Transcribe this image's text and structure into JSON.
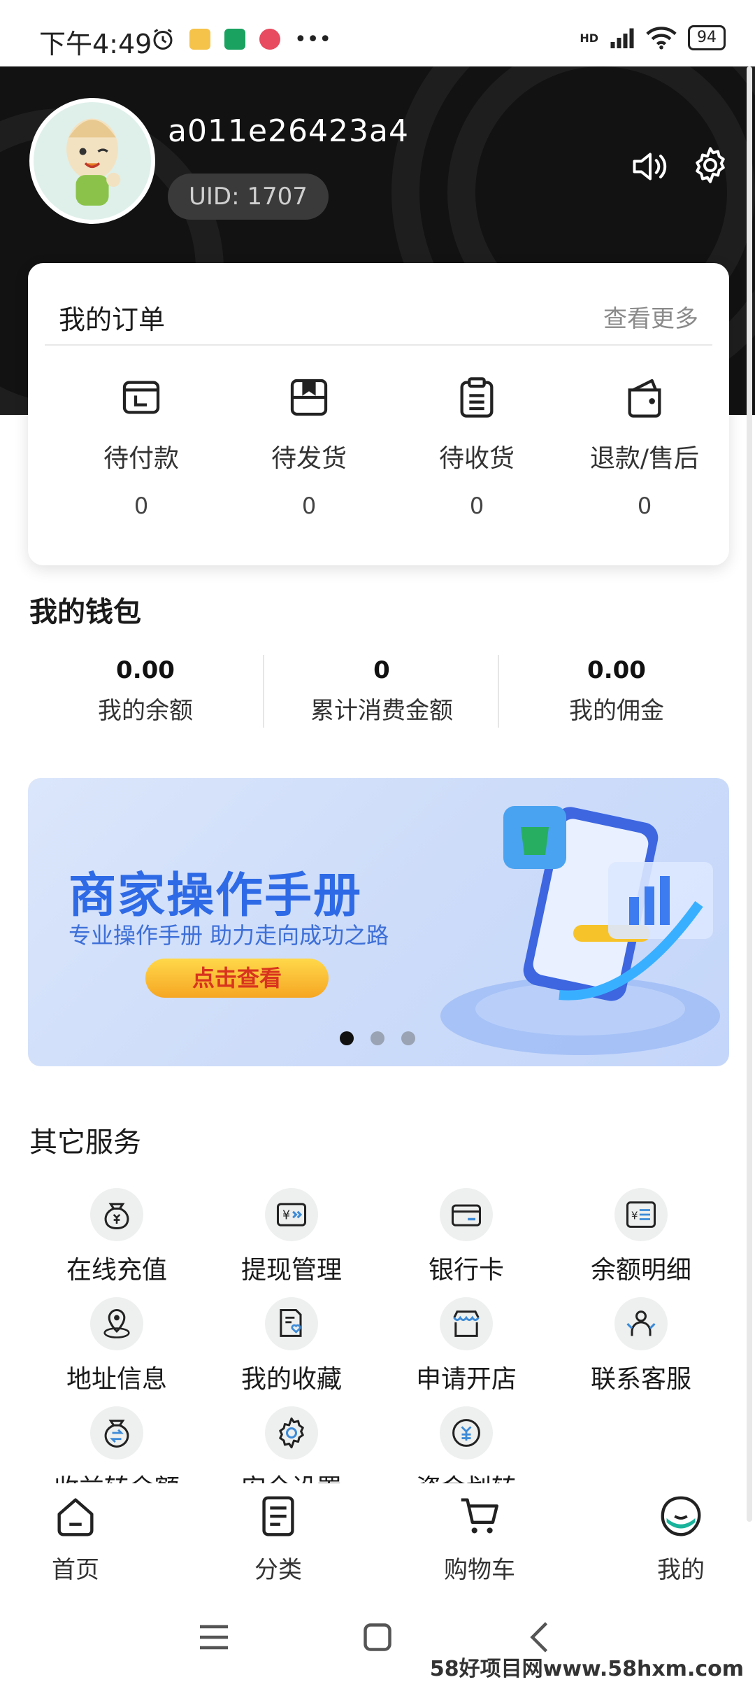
{
  "status_bar": {
    "time": "下午4:49",
    "network": "HD",
    "battery": "94"
  },
  "profile": {
    "username": "a011e26423a4",
    "uid": "UID: 1707"
  },
  "orders": {
    "title": "我的订单",
    "more": "查看更多",
    "items": [
      {
        "label": "待付款",
        "count": "0",
        "icon": "wallet-icon"
      },
      {
        "label": "待发货",
        "count": "0",
        "icon": "box-icon"
      },
      {
        "label": "待收货",
        "count": "0",
        "icon": "clipboard-icon"
      },
      {
        "label": "退款/售后",
        "count": "0",
        "icon": "bag-icon"
      }
    ]
  },
  "wallet": {
    "title": "我的钱包",
    "items": [
      {
        "value": "0.00",
        "label": "我的余额"
      },
      {
        "value": "0",
        "label": "累计消费金额"
      },
      {
        "value": "0.00",
        "label": "我的佣金"
      }
    ]
  },
  "banner": {
    "title": "商家操作手册",
    "subtitle": "专业操作手册 助力走向成功之路",
    "button": "点击查看",
    "page_count": 3,
    "active_page": 1
  },
  "services": {
    "title": "其它服务",
    "items": [
      {
        "label": "在线充值",
        "icon": "money-bag-icon"
      },
      {
        "label": "提现管理",
        "icon": "withdraw-icon"
      },
      {
        "label": "银行卡",
        "icon": "bank-card-icon"
      },
      {
        "label": "余额明细",
        "icon": "balance-detail-icon"
      },
      {
        "label": "地址信息",
        "icon": "location-icon"
      },
      {
        "label": "我的收藏",
        "icon": "favorite-icon"
      },
      {
        "label": "申请开店",
        "icon": "shop-icon"
      },
      {
        "label": "联系客服",
        "icon": "customer-service-icon"
      },
      {
        "label": "收益转余额",
        "icon": "transfer-bag-icon"
      },
      {
        "label": "安全设置",
        "icon": "gear-icon"
      },
      {
        "label": "资金划转",
        "icon": "fund-transfer-icon"
      }
    ]
  },
  "tabs": [
    {
      "label": "首页",
      "icon": "home-icon"
    },
    {
      "label": "分类",
      "icon": "category-icon"
    },
    {
      "label": "购物车",
      "icon": "cart-icon"
    },
    {
      "label": "我的",
      "icon": "profile-icon"
    }
  ],
  "watermark": "58好项目网www.58hxm.com",
  "colors": {
    "header_bg": "#121212",
    "accent": "#1ab39b",
    "banner_blue": "#2f6ae6"
  }
}
